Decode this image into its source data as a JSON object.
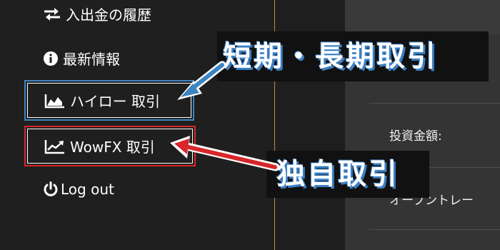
{
  "sidebar": {
    "items": [
      {
        "label": "入出金の履歴",
        "icon": "exchange-arrows-icon"
      },
      {
        "label": "最新情報",
        "icon": "info-circle-icon"
      },
      {
        "label": "ハイロー 取引",
        "icon": "area-chart-icon"
      },
      {
        "label": "WowFX 取引",
        "icon": "line-chart-icon"
      },
      {
        "label": "Log out",
        "icon": "power-icon"
      }
    ]
  },
  "main": {
    "investment_label": "投資金額:",
    "open_trade_label": "オープントレー"
  },
  "annotations": {
    "callout_top": "短期・長期取引",
    "callout_bottom": "独自取引",
    "colors": {
      "blue": "#3d84c2",
      "red": "#d8262a",
      "accent_line": "#b8922e"
    }
  }
}
